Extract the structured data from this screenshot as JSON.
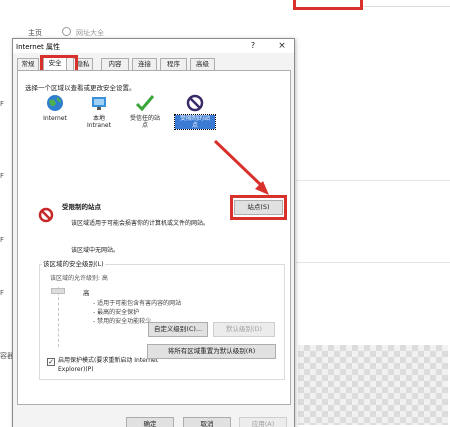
{
  "background": {
    "home_label": "主页",
    "radio_label": "网址大全",
    "left_edge_chars": [
      "F",
      "F",
      "F",
      "F",
      "容器"
    ]
  },
  "dialog": {
    "title": "Internet 属性",
    "help": "?",
    "close": "×",
    "tabs": [
      "常规",
      "安全",
      "隐私",
      "内容",
      "连接",
      "程序",
      "高级"
    ],
    "active_tab": "安全",
    "prompt": "选择一个区域以查看或更改安全设置。",
    "zones": [
      {
        "label": "Internet",
        "icon": "globe-icon"
      },
      {
        "label": "本地\nIntranet",
        "icon": "intranet-icon"
      },
      {
        "label": "受信任的站\n点",
        "icon": "checkmark-icon"
      },
      {
        "label": "受限制的站\n点",
        "icon": "restricted-icon"
      }
    ],
    "zone_info": {
      "title": "受限制的站点",
      "description": "该区域适用于可能会损害你的计算机或文件的网站。",
      "no_sites": "该区域中无网站。"
    },
    "sites_button": "站点(S)",
    "security_level": {
      "group_label": "该区域的安全级别(L)",
      "allowed_text": "该区域的允许级别: 高",
      "level": "高",
      "bullets": [
        "- 适用于可能包含有害内容的网站",
        "- 最高的安全保护",
        "- 禁用的安全功能较少"
      ]
    },
    "protected_mode": {
      "checked": true,
      "label": "启用保护模式(要求重新启动 Internet Explorer)(P)"
    },
    "custom_level_button": "自定义级别(C)...",
    "default_level_button": "默认级别(D)",
    "reset_all_button": "将所有区域重置为默认级别(R)",
    "ok_button": "确定",
    "cancel_button": "取消",
    "apply_button": "应用(A)"
  },
  "colors": {
    "highlight_red": "#d8302b",
    "selection_blue": "#3b7bd4"
  }
}
